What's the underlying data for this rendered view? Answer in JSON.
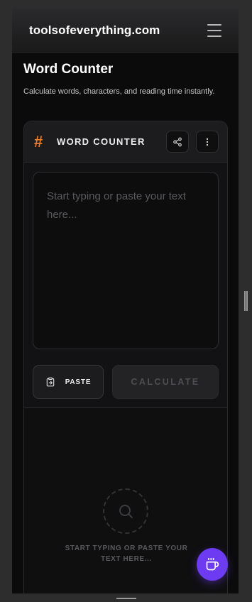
{
  "header": {
    "brand": "toolsofeverything.com",
    "menu_icon": "menu-icon"
  },
  "page": {
    "title": "Word Counter",
    "subtitle": "Calculate words, characters, and reading time instantly."
  },
  "tool": {
    "title": "WORD COUNTER",
    "title_icon": "hash-icon",
    "share_icon": "share-icon",
    "more_icon": "more-vertical-icon",
    "input": {
      "value": "",
      "placeholder": "Start typing or paste your text here..."
    },
    "paste_label": "PASTE",
    "paste_icon": "clipboard-icon",
    "calculate_label": "CALCULATE",
    "empty_state": {
      "icon": "search-icon",
      "text": "START TYPING OR PASTE YOUR TEXT HERE..."
    }
  },
  "fab": {
    "icon": "coffee-icon"
  },
  "colors": {
    "accent": "#f47b20",
    "fab": "#6c3bf2",
    "background": "#0b0b0c"
  }
}
